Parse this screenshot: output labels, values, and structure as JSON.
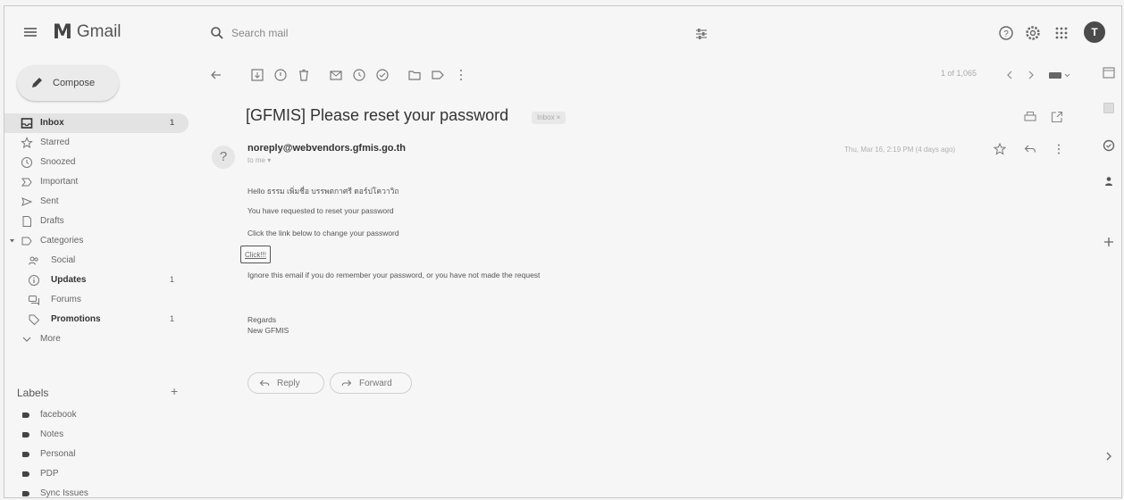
{
  "app": {
    "name": "Gmail",
    "avatar_letter": "T"
  },
  "search": {
    "placeholder": "Search mail"
  },
  "compose": {
    "label": "Compose"
  },
  "nav": [
    {
      "label": "Inbox",
      "count": "1",
      "icon": "inbox-icon",
      "active": true
    },
    {
      "label": "Starred",
      "count": "",
      "icon": "star-icon"
    },
    {
      "label": "Snoozed",
      "count": "",
      "icon": "clock-icon"
    },
    {
      "label": "Important",
      "count": "",
      "icon": "important-icon"
    },
    {
      "label": "Sent",
      "count": "",
      "icon": "send-icon"
    },
    {
      "label": "Drafts",
      "count": "",
      "icon": "draft-icon"
    },
    {
      "label": "Categories",
      "count": "",
      "icon": "label-icon"
    },
    {
      "label": "Social",
      "count": "",
      "icon": "people-icon"
    },
    {
      "label": "Updates",
      "count": "1",
      "icon": "info-icon"
    },
    {
      "label": "Forums",
      "count": "",
      "icon": "forum-icon"
    },
    {
      "label": "Promotions",
      "count": "1",
      "icon": "tag-icon"
    },
    {
      "label": "More",
      "count": "",
      "icon": "chevron-down-icon"
    }
  ],
  "labels": {
    "title": "Labels",
    "add": "+",
    "items": [
      "facebook",
      "Notes",
      "Personal",
      "PDP",
      "Sync Issues"
    ]
  },
  "toolbar": {
    "pager": "1 of 1,065"
  },
  "email": {
    "subject": "[GFMIS] Please reset your password",
    "chip": "Inbox ×",
    "sender_avatar": "?",
    "sender": "noreply@webvendors.gfmis.go.th",
    "to": "to me ▾",
    "date": "Thu, Mar 16, 2:19 PM (4 days ago)",
    "body": [
      "Hello ธรรม เพิ่มชื่อ บรรพตกาศรี ดอร์ปโควาวิถ",
      "You have requested to reset your password",
      "Click the link below to change your password"
    ],
    "link_label": "Click!!!",
    "ignore_line": "Ignore this email if you do remember your password, or you have not made the request",
    "regards": "Regards",
    "signature": "New GFMIS"
  },
  "actions": {
    "reply": "Reply",
    "forward": "Forward"
  }
}
